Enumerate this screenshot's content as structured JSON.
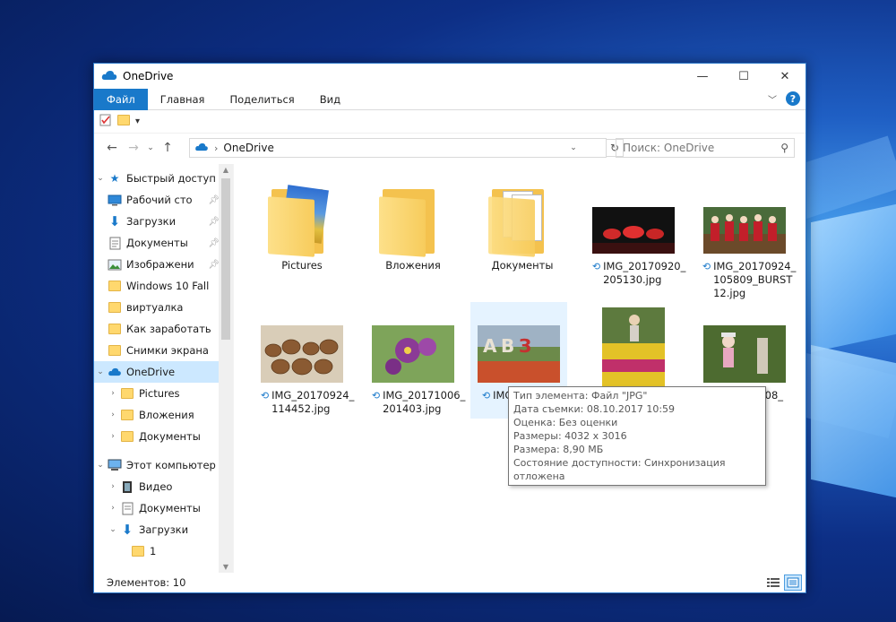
{
  "window": {
    "title": "OneDrive",
    "controls": {
      "minimize": "—",
      "maximize": "☐",
      "close": "✕"
    }
  },
  "ribbon": {
    "tabs": [
      "Файл",
      "Главная",
      "Поделиться",
      "Вид"
    ]
  },
  "address": {
    "crumbs": [
      "OneDrive"
    ],
    "search_placeholder": "Поиск: OneDrive"
  },
  "sidebar": {
    "quick_access": "Быстрый доступ",
    "pinned": [
      {
        "label": "Рабочий сто",
        "icon": "desktop-icon",
        "pinned": true
      },
      {
        "label": "Загрузки",
        "icon": "download-icon",
        "pinned": true
      },
      {
        "label": "Документы",
        "icon": "documents-icon",
        "pinned": true
      },
      {
        "label": "Изображени",
        "icon": "pictures-icon",
        "pinned": true
      },
      {
        "label": "Windows 10 Fall",
        "icon": "folder-icon",
        "pinned": false
      },
      {
        "label": "виртуалка",
        "icon": "folder-icon",
        "pinned": false
      },
      {
        "label": "Как заработать",
        "icon": "folder-icon",
        "pinned": false
      },
      {
        "label": "Снимки экрана",
        "icon": "folder-icon",
        "pinned": false
      }
    ],
    "onedrive": "OneDrive",
    "onedrive_items": [
      "Pictures",
      "Вложения",
      "Документы"
    ],
    "this_pc": "Этот компьютер",
    "pc_items": [
      "Видео",
      "Документы",
      "Загрузки"
    ],
    "downloads_child": "1"
  },
  "files": [
    {
      "name": "Pictures",
      "type": "folder",
      "sync": false
    },
    {
      "name": "Вложения",
      "type": "folder",
      "sync": false
    },
    {
      "name": "Документы",
      "type": "folder",
      "sync": false
    },
    {
      "name": "IMG_20170920_ 205130.jpg",
      "type": "image",
      "sync": true
    },
    {
      "name": "IMG_20170924_ 105809_BURST 12.jpg",
      "type": "image",
      "sync": true
    },
    {
      "name": "IMG_20170924_ 114452.jpg",
      "type": "image",
      "sync": true
    },
    {
      "name": "IMG_20171006_ 201403.jpg",
      "type": "image",
      "sync": true
    },
    {
      "name": "IMG_ 105",
      "type": "image",
      "sync": true
    },
    {
      "name": "",
      "type": "image",
      "sync": false
    },
    {
      "name": "_08_",
      "type": "image",
      "sync": false
    }
  ],
  "tooltip": [
    "Тип элемента: Файл \"JPG\"",
    "Дата съемки: 08.10.2017 10:59",
    "Оценка: Без оценки",
    "Размеры: 4032 x 3016",
    "Размера: 8,90 МБ",
    "Состояние доступности: Синхронизация отложена"
  ],
  "status": {
    "items": "Элементов: 10"
  },
  "colors": {
    "accent": "#1979ca",
    "selection": "#cce8ff",
    "hover": "#e5f3ff",
    "folder": "#ffd86e"
  }
}
